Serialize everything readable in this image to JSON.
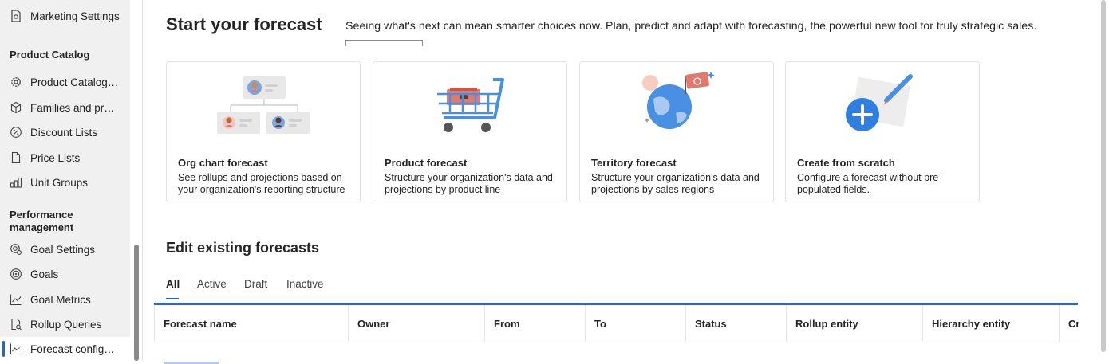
{
  "sidebar": {
    "top_item": {
      "label": "Marketing Settings",
      "icon": "settings-doc-icon"
    },
    "sections": [
      {
        "title": "Product Catalog",
        "items": [
          {
            "label": "Product Catalog S...",
            "icon": "gear-icon"
          },
          {
            "label": "Families and prod...",
            "icon": "cube-icon"
          },
          {
            "label": "Discount Lists",
            "icon": "percent-icon"
          },
          {
            "label": "Price Lists",
            "icon": "document-icon"
          },
          {
            "label": "Unit Groups",
            "icon": "unit-groups-icon"
          }
        ]
      },
      {
        "title_line1": "Performance",
        "title_line2": "management",
        "items": [
          {
            "label": "Goal Settings",
            "icon": "goal-settings-icon"
          },
          {
            "label": "Goals",
            "icon": "target-icon"
          },
          {
            "label": "Goal Metrics",
            "icon": "line-chart-icon"
          },
          {
            "label": "Rollup Queries",
            "icon": "query-icon"
          },
          {
            "label": "Forecast configur...",
            "icon": "forecast-chart-icon",
            "active": true
          }
        ]
      }
    ]
  },
  "main": {
    "title": "Start your forecast",
    "description": "Seeing what's next can mean smarter choices now. Plan, predict and adapt with forecasting, the powerful new tool for truly strategic sales.",
    "cards": [
      {
        "title": "Org chart forecast",
        "description": "See rollups and projections based on your organization's reporting structure"
      },
      {
        "title": "Product forecast",
        "description": "Structure your organization's data and projections by product line"
      },
      {
        "title": "Territory forecast",
        "description": "Structure your organization's data and projections by sales regions"
      },
      {
        "title": "Create from scratch",
        "description": "Configure a forecast without pre-populated fields."
      }
    ],
    "edit_title": "Edit existing forecasts",
    "tabs": [
      {
        "label": "All",
        "active": true
      },
      {
        "label": "Active"
      },
      {
        "label": "Draft"
      },
      {
        "label": "Inactive"
      }
    ],
    "columns": [
      "Forecast name",
      "Owner",
      "From",
      "To",
      "Status",
      "Rollup entity",
      "Hierarchy entity",
      "Cr"
    ]
  },
  "colors": {
    "accent": "#2266cf",
    "grid_top_border": "#2e67c6",
    "sidebar_bg": "#f0f0f0"
  }
}
